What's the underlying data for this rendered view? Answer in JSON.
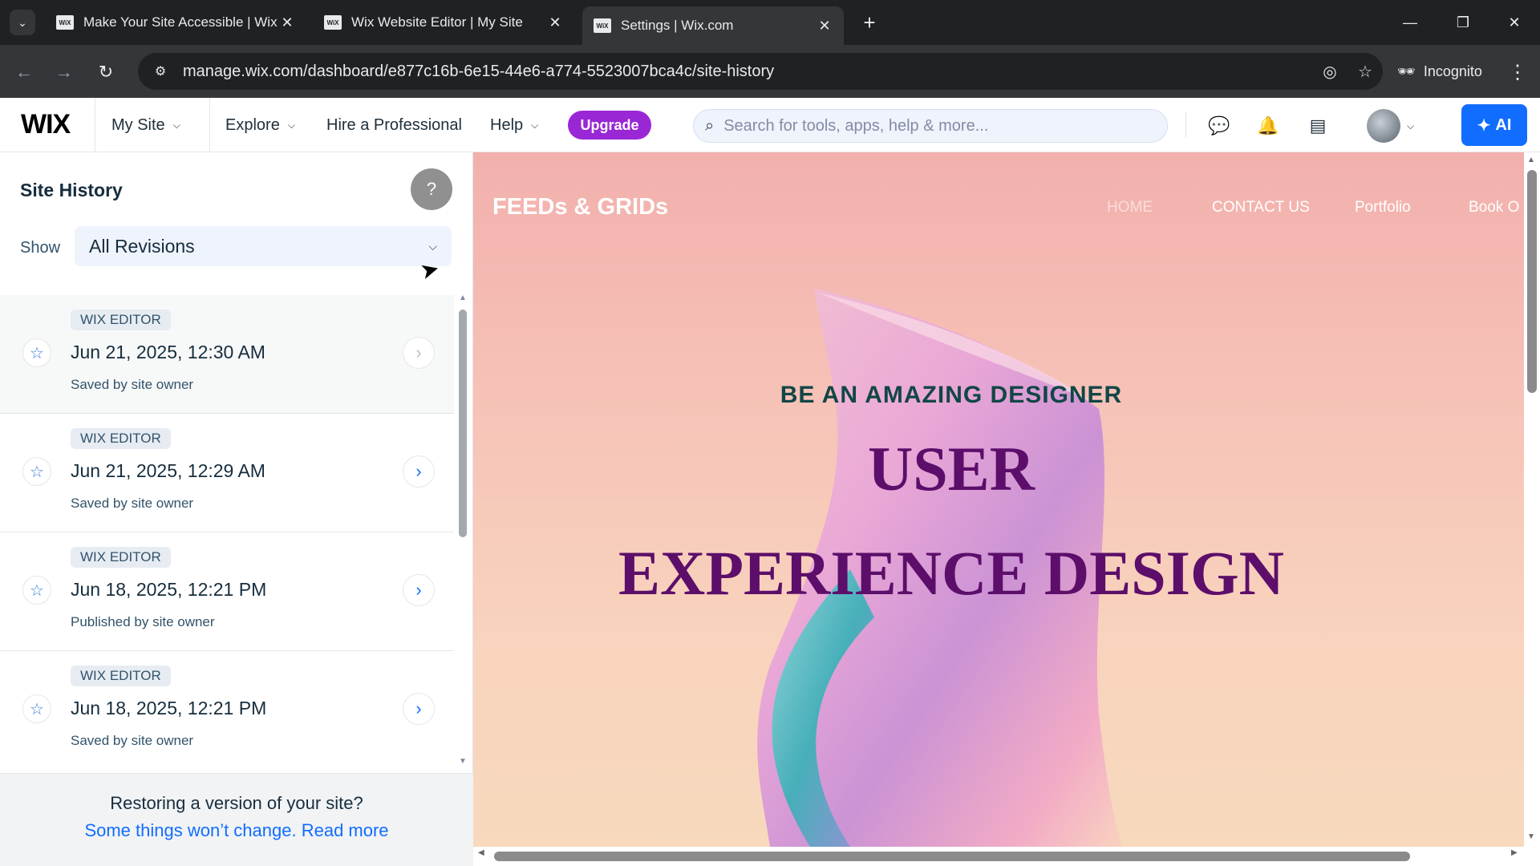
{
  "browser": {
    "tabs": [
      {
        "title": "Make Your Site Accessible | Wix",
        "favicon": "WiX"
      },
      {
        "title": "Wix Website Editor | My Site",
        "favicon": "WiX"
      },
      {
        "title": "Settings | Wix.com",
        "favicon": "WiX"
      }
    ],
    "url": "manage.wix.com/dashboard/e877c16b-6e15-44e6-a774-5523007bca4c/site-history",
    "incognito_label": "Incognito"
  },
  "wix_header": {
    "logo": "WIX",
    "my_site": "My Site",
    "explore": "Explore",
    "hire": "Hire a Professional",
    "help": "Help",
    "upgrade": "Upgrade",
    "search_placeholder": "Search for tools, apps, help & more...",
    "ai_label": "AI"
  },
  "panel": {
    "title": "Site History",
    "help_glyph": "?",
    "show_label": "Show",
    "filter_value": "All Revisions",
    "revisions": [
      {
        "badge": "WIX EDITOR",
        "date": "Jun 21, 2025, 12:30 AM",
        "by": "Saved by site owner"
      },
      {
        "badge": "WIX EDITOR",
        "date": "Jun 21, 2025, 12:29 AM",
        "by": "Saved by site owner"
      },
      {
        "badge": "WIX EDITOR",
        "date": "Jun 18, 2025, 12:21 PM",
        "by": "Published by site owner"
      },
      {
        "badge": "WIX EDITOR",
        "date": "Jun 18, 2025, 12:21 PM",
        "by": "Saved by site owner"
      }
    ],
    "footer_question": "Restoring a version of your site?",
    "footer_link": "Some things won’t change. Read more"
  },
  "preview": {
    "site_logo": "FEEDs & GRIDs",
    "nav": [
      "HOME",
      "CONTACT US",
      "Portfolio",
      "Book O"
    ],
    "tagline": "BE AN AMAZING DESIGNER",
    "heading_line1": "USER",
    "heading_line2": "EXPERIENCE DESIGN"
  }
}
